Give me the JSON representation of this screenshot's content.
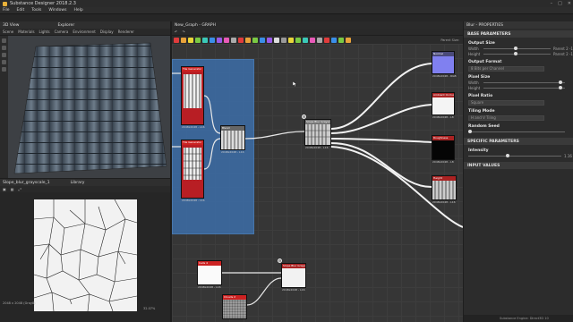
{
  "app": {
    "title": "Substance Designer 2018.2.3"
  },
  "menu": [
    "File",
    "Edit",
    "Tools",
    "Windows",
    "Help"
  ],
  "view3d": {
    "title": "3D View",
    "menus": [
      "Scene",
      "Materials",
      "Lights",
      "Camera",
      "Environment",
      "Display",
      "Renderer"
    ]
  },
  "explorer": {
    "title": "Explorer"
  },
  "view2d": {
    "title": "Slope_blur_grayscale_1",
    "library_tab": "Library",
    "size_label": "2048 x 2048 (Gray8)",
    "zoom": "32.07%"
  },
  "graph": {
    "title": "New_Graph - GRAPH",
    "parent_size_label": "Parent Size:",
    "toolbar_colors": [
      "#e03c3c",
      "#e8a23a",
      "#e8d53a",
      "#7ac943",
      "#3ac9b8",
      "#3a8ee8",
      "#9a5ae8",
      "#e85ab8",
      "#aaaaaa",
      "#e03c3c",
      "#e8a23a",
      "#7ac943",
      "#3a8ee8",
      "#9a5ae8",
      "#dddddd",
      "#999999",
      "#e8d53a",
      "#7ac943",
      "#3ac9b8",
      "#e85ab8",
      "#aaaaaa",
      "#e03c3c",
      "#3a8ee8",
      "#7ac943",
      "#e8a23a"
    ],
    "frame_color": "#3c6ea8",
    "nodes": {
      "tile_top": {
        "label": "Tile Generator",
        "foot": "2048x2048 - L16"
      },
      "tile_bottom": {
        "label": "Tile Generator",
        "foot": "2048x2048 - L16"
      },
      "blend_mid": {
        "label": "Blend",
        "foot": "2048x2048 - L16"
      },
      "slope_blur": {
        "label": "Slope Blur Grayscale",
        "foot": "2048x2048 - L16"
      },
      "normal_out": {
        "label": "Normal",
        "foot": "2048x2048 - RGB"
      },
      "output_ao": {
        "label": "Ambient Occlusion",
        "foot": "2048x2048 - L8"
      },
      "output_rough": {
        "label": "Roughness",
        "foot": "2048x2048 - L8"
      },
      "output_height": {
        "label": "Height",
        "foot": "2048x2048 - L16"
      },
      "cells_node": {
        "label": "Cells 4",
        "foot": "2048x2048 - L16"
      },
      "noise_node": {
        "label": "Clouds 2",
        "foot": "2048x2048 - L16"
      },
      "slope_blur_2": {
        "label": "Slope Blur Grayscale",
        "foot": "2048x2048 - L16"
      }
    }
  },
  "properties": {
    "title": "Blur - PROPERTIES",
    "sections": {
      "base": "BASE PARAMETERS",
      "specific": "SPECIFIC PARAMETERS",
      "input": "INPUT VALUES"
    },
    "output_size": {
      "label": "Output Size",
      "width_label": "Width",
      "height_label": "Height",
      "width_value": "Parent 2 -1",
      "height_value": "Parent 2 -1"
    },
    "output_format": {
      "label": "Output Format",
      "value": "8 Bits per Channel"
    },
    "pixel_size": {
      "label": "Pixel Size",
      "width_label": "Width",
      "height_label": "Height"
    },
    "pixel_ratio": {
      "label": "Pixel Ratio",
      "value": "Square"
    },
    "tiling_mode": {
      "label": "Tiling Mode",
      "value": "H and V Tiling"
    },
    "random_seed": {
      "label": "Random Seed"
    },
    "intensity": {
      "label": "Intensity",
      "value": "1.16",
      "level": 0.4
    }
  },
  "status": {
    "engine": "Substance Engine: Direct3D 10"
  }
}
